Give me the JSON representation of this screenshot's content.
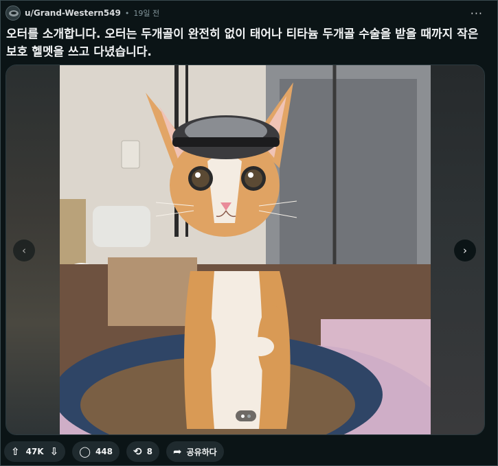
{
  "post": {
    "username": "u/Grand-Western549",
    "separator": "•",
    "time": "19일 전",
    "more_icon": "more-horizontal-icon",
    "more_glyph": "···",
    "title": "오터를 소개합니다. 오터는 두개골이 완전히 없이 태어나 티타늄 두개골 수술을 받을 때까지 작은 보호 헬멧을 쓰고 다녔습니다."
  },
  "media": {
    "image_description_icon": "photo",
    "prev_glyph": "‹",
    "next_glyph": "›",
    "slide_count": 2,
    "active_slide": 1
  },
  "actions": {
    "upvote_glyph": "⇧",
    "downvote_glyph": "⇩",
    "votes": "47K",
    "comment_glyph": "◯",
    "comments": "448",
    "crosspost_glyph": "⟲",
    "crossposts": "8",
    "share_glyph": "➦",
    "share_label": "공유하다"
  },
  "colors": {
    "background": "#0b1416",
    "pill": "#1f2a2e",
    "text": "#f2f4f5",
    "meta": "#82959b"
  }
}
